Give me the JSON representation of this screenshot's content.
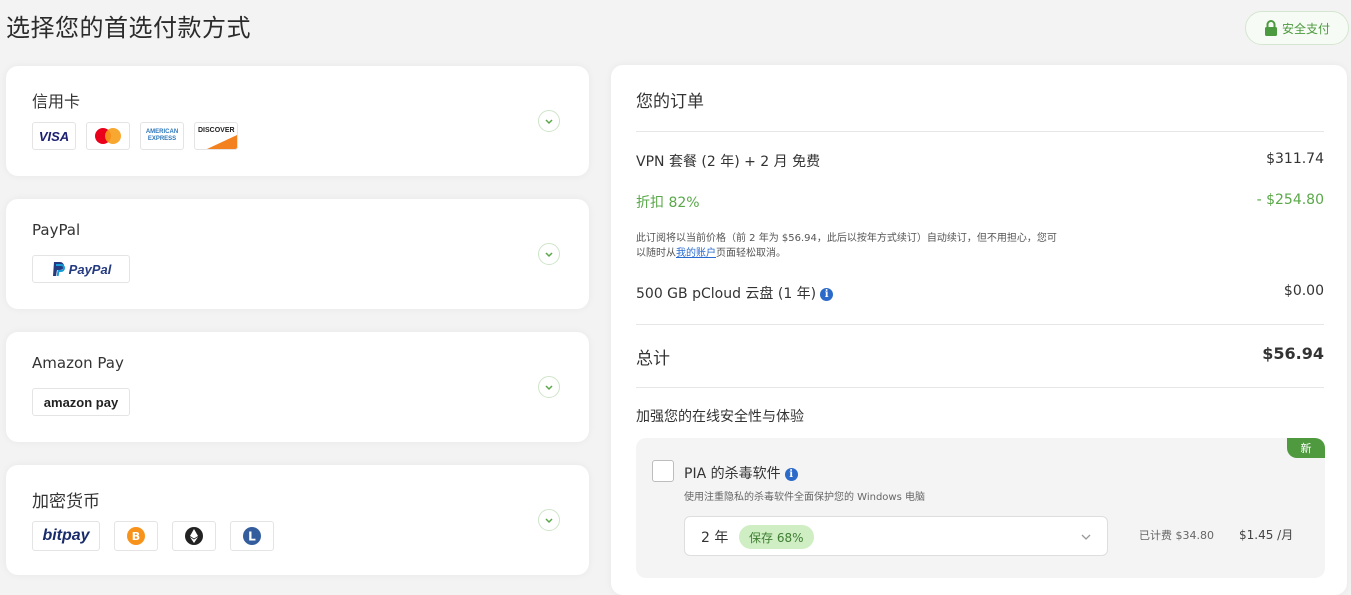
{
  "page": {
    "title": "选择您的首选付款方式",
    "secure_label": "安全支付"
  },
  "colors": {
    "accent_green": "#5aa84a",
    "link_blue": "#2a6bd1",
    "info_blue": "#2b6ac9"
  },
  "payment_methods": [
    {
      "label": "信用卡",
      "logos": [
        "VISA",
        "mastercard",
        "AMERICAN EXPRESS",
        "DISCOVER"
      ]
    },
    {
      "label": "PayPal",
      "logos": [
        "PayPal"
      ]
    },
    {
      "label": "Amazon Pay",
      "logos": [
        "amazon pay"
      ]
    },
    {
      "label": "加密货币",
      "logos": [
        "bitpay",
        "bitcoin-icon",
        "ethereum-icon",
        "litecoin-icon"
      ]
    }
  ],
  "order": {
    "heading": "您的订单",
    "plan_label": "VPN 套餐 (2 年) + 2 月 免费",
    "plan_price": "$311.74",
    "discount_label": "折扣 82%",
    "discount_value": "- $254.80",
    "renew_note_1": "此订阅将以当前价格（前 2 年为 $56.94，此后以按年方式续订）自动续订，但不用担心，您可",
    "renew_note_2a": "以随时从",
    "renew_note_link": "我的账户",
    "renew_note_2b": "页面轻松取消。",
    "cloud_label": "500 GB pCloud 云盘 (1 年)",
    "cloud_price": "$0.00",
    "total_label": "总计",
    "total_value": "$56.94",
    "upsell_heading": "加强您的在线安全性与体验",
    "addon": {
      "new_tag": "新",
      "title": "PIA 的杀毒软件",
      "desc": "使用注重隐私的杀毒软件全面保护您的 Windows 电脑",
      "term": "2 年",
      "save": "保存 68%",
      "billed": "已计费 $34.80",
      "monthly": "$1.45 /月"
    }
  }
}
